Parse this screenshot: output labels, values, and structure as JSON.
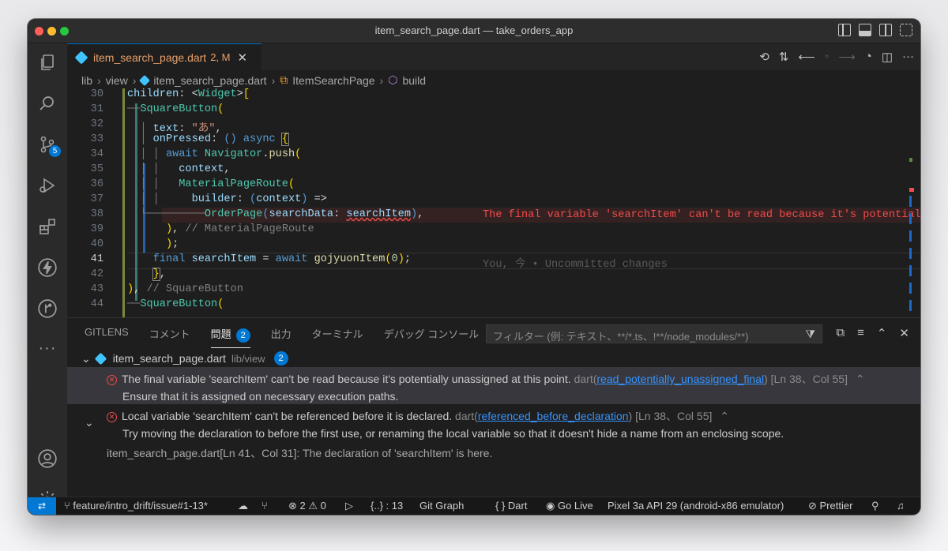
{
  "window": {
    "title": "item_search_page.dart — take_orders_app"
  },
  "activity_bar": {
    "scm_badge": "5",
    "items": [
      "explorer-icon",
      "search-icon",
      "source-control-icon",
      "run-debug-icon",
      "extensions-icon",
      "lightning-icon",
      "gitgraph-icon",
      "more-icon",
      "account-icon",
      "settings-gear-icon"
    ]
  },
  "tab": {
    "filename": "item_search_page.dart",
    "status": "2, M",
    "close": "✕"
  },
  "breadcrumb": {
    "parts": [
      "lib",
      "view",
      "item_search_page.dart",
      "ItemSearchPage",
      "build"
    ]
  },
  "editor": {
    "line_numbers": [
      "30",
      "31",
      "32",
      "33",
      "34",
      "35",
      "36",
      "37",
      "38",
      "39",
      "40",
      "41",
      "42",
      "43",
      "44"
    ],
    "inline_error": "The final variable 'searchItem' can't be read because it's potentially unassig",
    "blame": "You, 今 • Uncommitted changes"
  },
  "panel": {
    "tabs": [
      "GITLENS",
      "コメント",
      "問題",
      "出力",
      "ターミナル",
      "デバッグ コンソール"
    ],
    "problems_count": "2",
    "filter_placeholder": "フィルター (例: テキスト、**/*.ts、!**/node_modules/**)",
    "file": {
      "name": "item_search_page.dart",
      "path": "lib/view",
      "count": "2"
    },
    "problems": [
      {
        "message": "The final variable 'searchItem' can't be read because it's potentially unassigned at this point.",
        "source": "dart(",
        "code": "read_potentially_unassigned_final",
        "source_end": ")",
        "location": "[Ln 38、Col 55]",
        "hint": "Ensure that it is assigned on necessary execution paths."
      },
      {
        "message": "Local variable 'searchItem' can't be referenced before it is declared.",
        "source": "dart(",
        "code": "referenced_before_declaration",
        "source_end": ")",
        "location": "[Ln 38、Col 55]",
        "hint": "Try moving the declaration to before the first use, or renaming the local variable so that it doesn't hide a name from an enclosing scope.",
        "related": "item_search_page.dart[Ln 41、Col 31]: The declaration of 'searchItem' is here."
      }
    ]
  },
  "status_bar": {
    "branch": "feature/intro_drift/issue#1-13*",
    "problems": "⊗ 2 ⚠ 0",
    "brackets": "{..} : 13",
    "git_graph": "Git Graph",
    "language": "{ } Dart",
    "go_live": "Go Live",
    "device": "Pixel 3a API 29 (android-x86 emulator)",
    "prettier": "Prettier"
  },
  "colors": {
    "accent": "#0078d4",
    "error": "#f14c4c",
    "modified_tab": "#e8a06a"
  }
}
